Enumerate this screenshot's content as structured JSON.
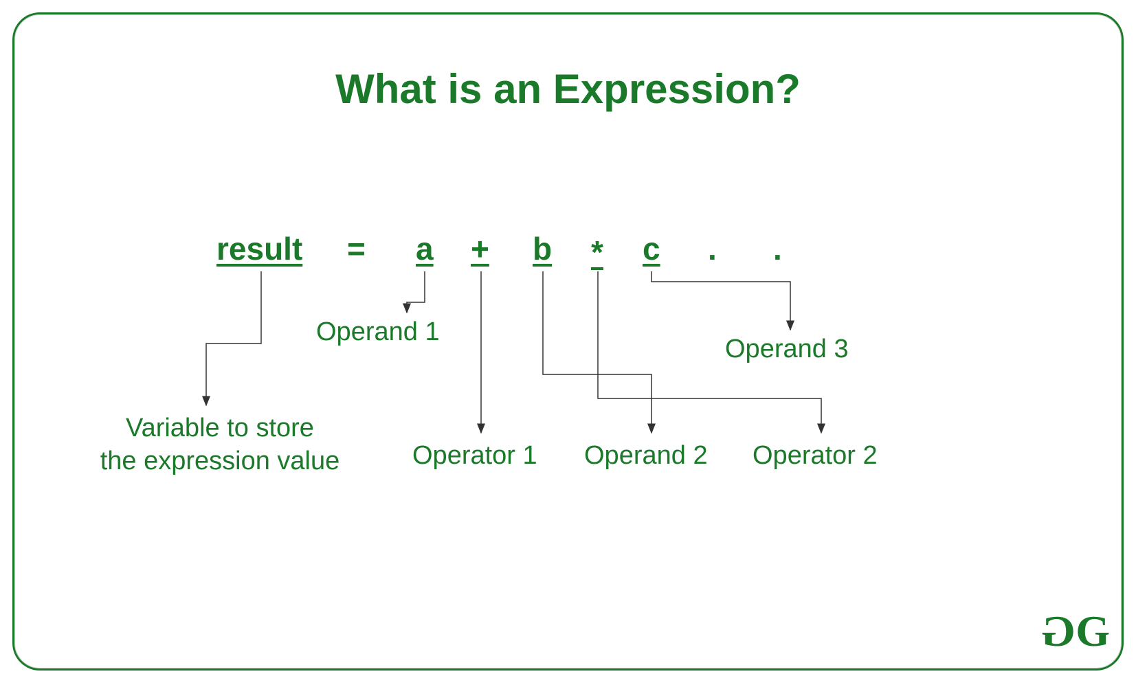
{
  "title": "What is an Expression?",
  "expression": {
    "result": "result",
    "equals": "=",
    "a": "a",
    "plus": "+",
    "b": "b",
    "star": "*",
    "c": "c",
    "dot1": ".",
    "dot2": "."
  },
  "labels": {
    "variable_line1": "Variable to store",
    "variable_line2": "the expression value",
    "operand1": "Operand 1",
    "operator1": "Operator 1",
    "operand2": "Operand 2",
    "operator2": "Operator 2",
    "operand3": "Operand 3"
  },
  "logo": "GG"
}
